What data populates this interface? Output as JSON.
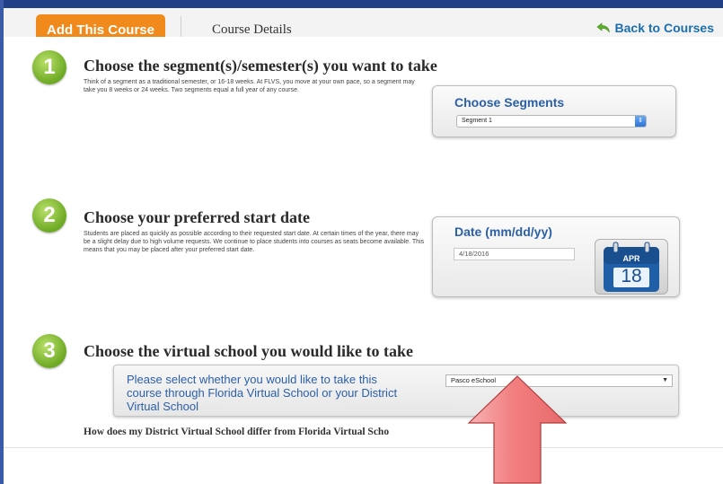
{
  "tabs": {
    "active_label": "Add This Course",
    "details_label": "Course Details",
    "back_label": "Back to Courses"
  },
  "step1": {
    "number": "1",
    "heading": "Choose the segment(s)/semester(s) you want to take",
    "description": "Think of a segment as a traditional semester, or 16-18 weeks. At FLVS, you move at your own pace, so a segment may take you 8 weeks or 24 weeks. Two segments equal a full year of any course.",
    "panel_title": "Choose Segments",
    "select_value": "Segment 1"
  },
  "step2": {
    "number": "2",
    "heading": "Choose your preferred start date",
    "description": "Students are placed as quickly as possible according to their requested start date. At certain times of the year, there may be a slight delay due to high volume requests. We continue to place students into courses as seats become available. This means that you may be placed after your preferred start date.",
    "panel_title": "Date (mm/dd/yy)",
    "date_value": "4/18/2016",
    "calendar_month": "APR",
    "calendar_day": "18"
  },
  "step3": {
    "number": "3",
    "heading": "Choose the virtual school you would like to take",
    "panel_text": "Please select whether you would like to take this course through Florida Virtual School or your District Virtual School",
    "select_value": "Pasco eSchool",
    "question": "How does my District Virtual School differ from Florida Virtual Scho"
  },
  "colors": {
    "tab_active": "#f08a1c",
    "link_blue": "#2b5fa8",
    "step_green": "#7cb82f",
    "overlay_arrow": "#f07f80"
  },
  "icons": {
    "back": "back-arrow-icon",
    "calendar": "calendar-icon",
    "overlay": "up-arrow-overlay"
  }
}
